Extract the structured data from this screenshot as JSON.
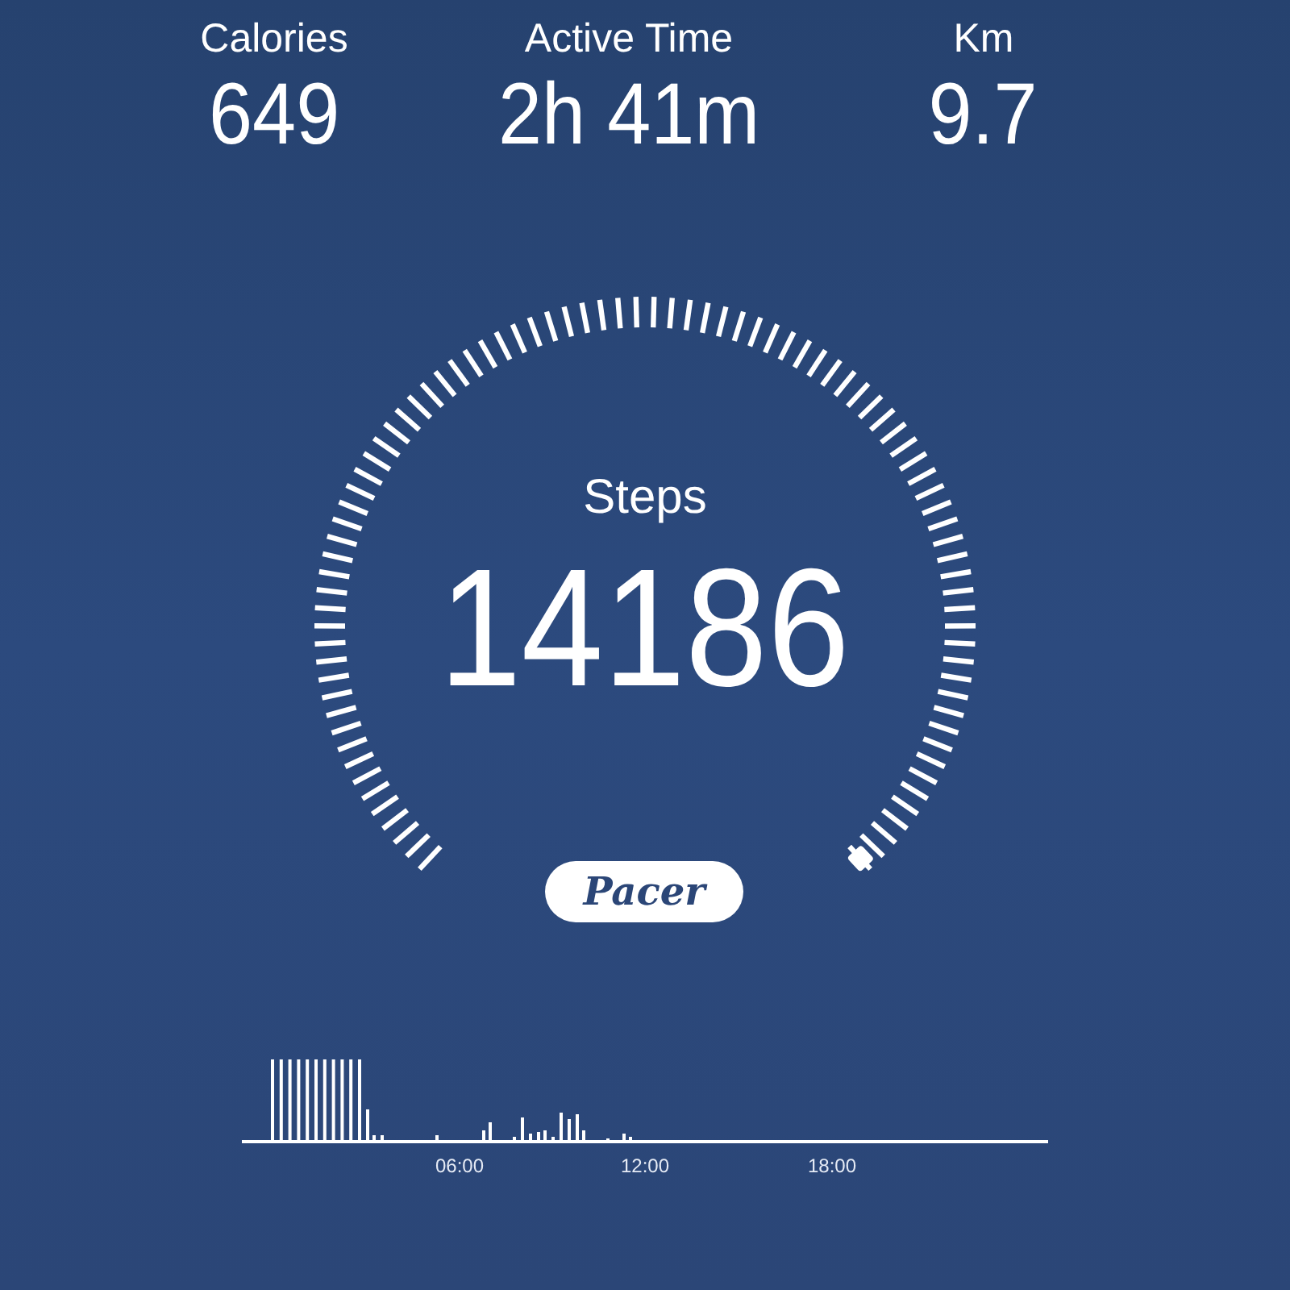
{
  "stats": [
    {
      "label": "Calories",
      "value": "649"
    },
    {
      "label": "Active Time",
      "value": "2h 41m"
    },
    {
      "label": "Km",
      "value": "9.7"
    }
  ],
  "gauge": {
    "label": "Steps",
    "value": "14186"
  },
  "logo": {
    "text": "Pacer"
  },
  "activity_chart": {
    "x_labels": [
      "06:00",
      "12:00",
      "18:00"
    ]
  }
}
